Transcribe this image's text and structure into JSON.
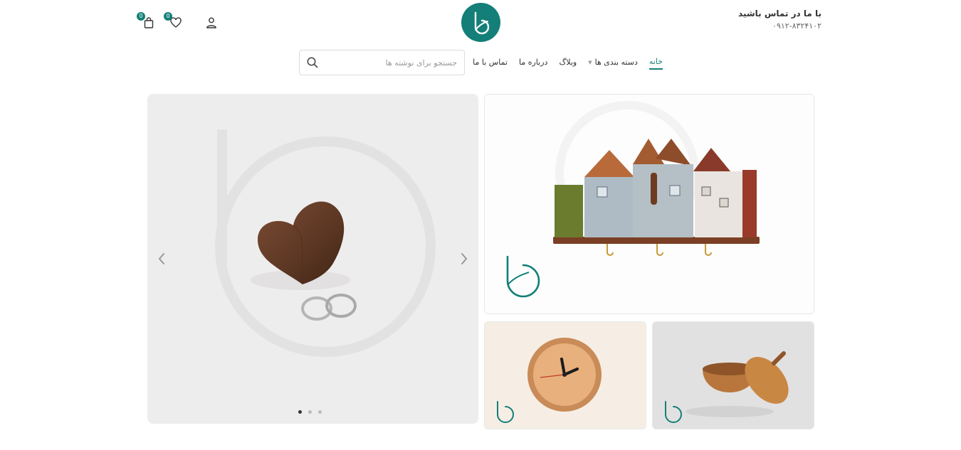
{
  "header": {
    "contact_title": "با ما در تماس باشید",
    "contact_phone": "۰۹۱۲-۸۳۲۴۱۰۲",
    "cart_count": "0",
    "wishlist_count": "0"
  },
  "nav": {
    "items": [
      {
        "label": "خانه",
        "active": true
      },
      {
        "label": "دسته بندی ها",
        "has_dropdown": true
      },
      {
        "label": "وبلاگ"
      },
      {
        "label": "درباره ما"
      },
      {
        "label": "تماس با ما"
      }
    ]
  },
  "search": {
    "placeholder": "جستجو برای نوشته ها",
    "value": ""
  },
  "slider": {
    "slide_count": 3,
    "active_slide": 1
  },
  "colors": {
    "brand": "#137f78",
    "text": "#333333",
    "border": "#dcdcdc"
  },
  "icons": {
    "cart": "shopping-bag-icon",
    "wishlist": "heart-icon",
    "account": "user-icon",
    "search": "search-icon"
  }
}
